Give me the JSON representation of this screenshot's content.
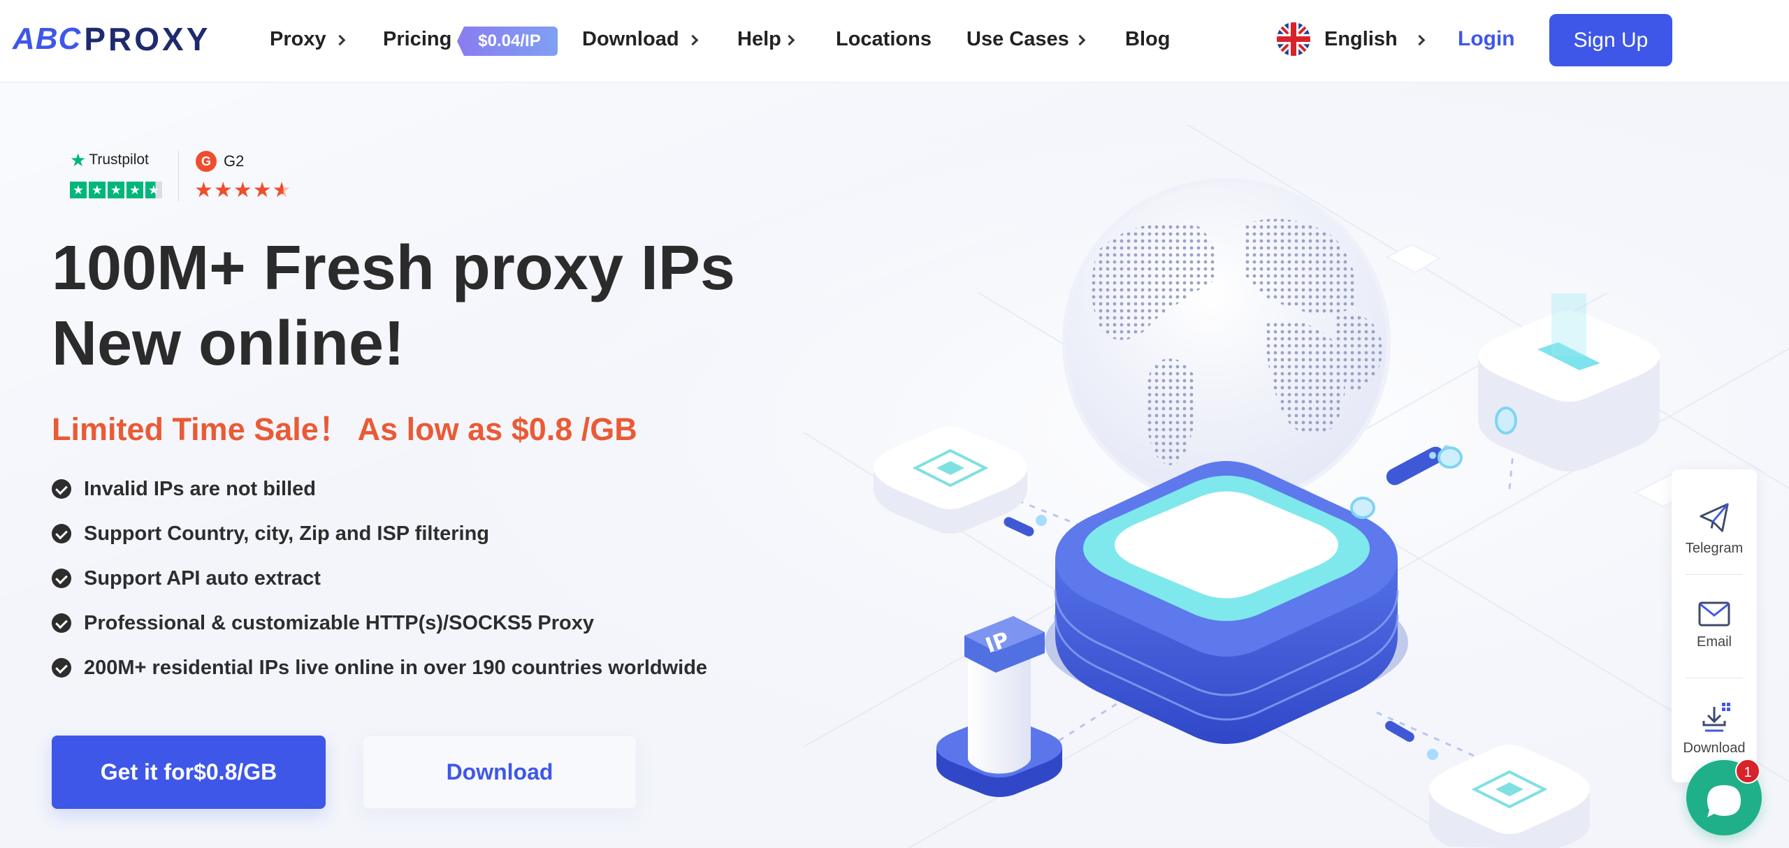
{
  "logo": {
    "abc": "ABC",
    "proxy": "PROXY"
  },
  "nav": {
    "proxy": "Proxy",
    "pricing": "Pricing",
    "pricing_badge": "$0.04/IP",
    "download": "Download",
    "help": "Help",
    "locations": "Locations",
    "use_cases": "Use Cases",
    "blog": "Blog",
    "language": "English",
    "login": "Login",
    "signup": "Sign Up"
  },
  "ratings": {
    "trustpilot": "Trustpilot",
    "trustpilot_stars": 5,
    "g2": "G2",
    "g2_stars": 4.5
  },
  "hero": {
    "headline_line1": "100M+ Fresh proxy IPs",
    "headline_line2": "New online!",
    "sale": "Limited Time Sale！ As low as $0.8 /GB",
    "features": [
      "Invalid IPs are not billed",
      "Support Country, city, Zip and ISP filtering",
      "Support API auto extract",
      "Professional & customizable HTTP(s)/SOCKS5 Proxy",
      "200M+ residential IPs live online in over 190 countries worldwide"
    ],
    "cta_primary": "Get it for$0.8/GB",
    "cta_secondary": "Download"
  },
  "illustration": {
    "tower_label": "IP"
  },
  "side_panel": {
    "telegram": "Telegram",
    "email": "Email",
    "download": "Download"
  },
  "chat": {
    "badge": "1"
  },
  "colors": {
    "brand_blue": "#3e57e8",
    "sale_orange": "#ea5a35",
    "trustpilot_green": "#00b67a",
    "g2_red": "#ef4d2d",
    "chat_green": "#20b089"
  }
}
